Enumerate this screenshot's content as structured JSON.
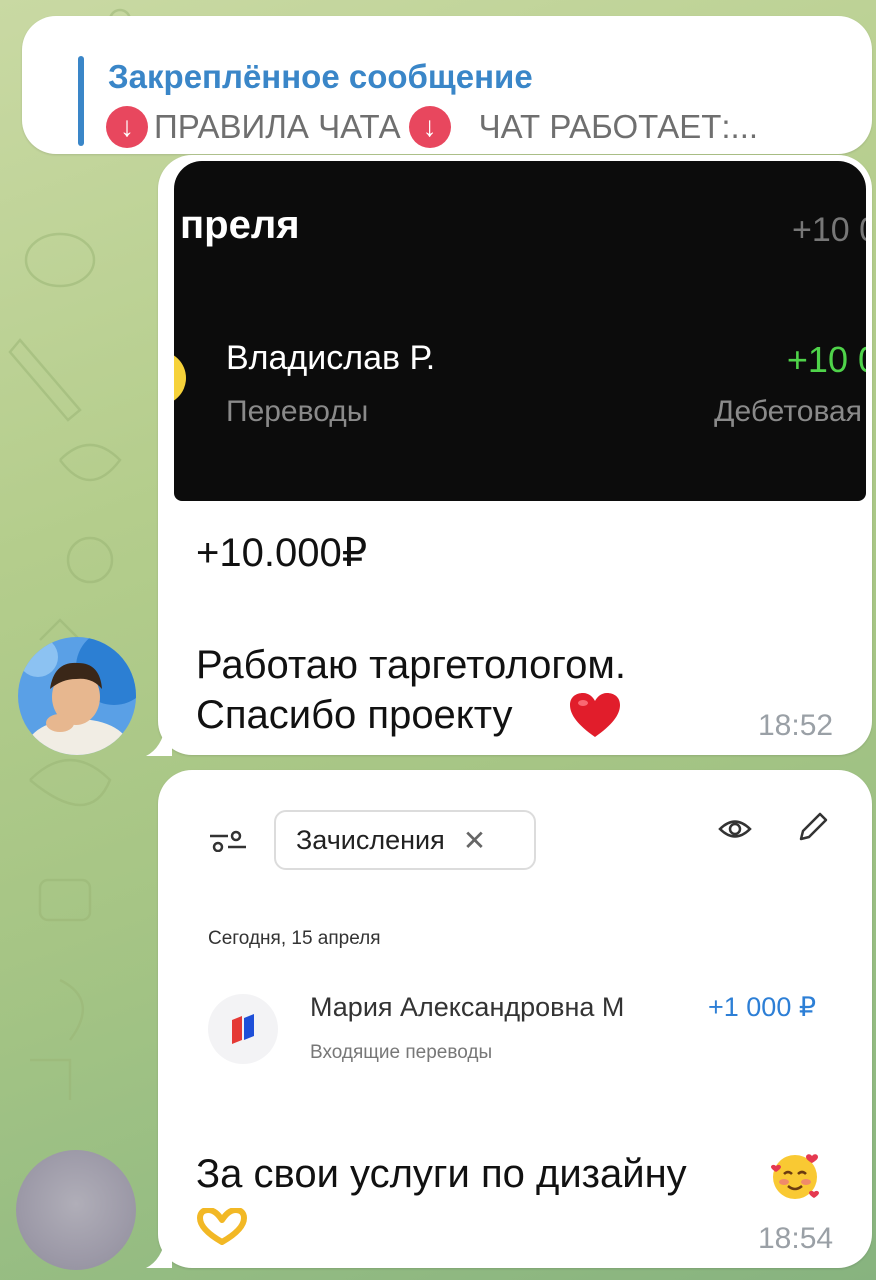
{
  "pinned": {
    "title": "Закреплённое сообщение",
    "preview_part1": "ПРАВИЛА ЧАТА",
    "preview_part2": "ЧАТ РАБОТАЕТ:..."
  },
  "message1": {
    "screenshot": {
      "month": "преля",
      "top_amount": "+10 0",
      "name": "Владислав Р.",
      "amount": "+10 0",
      "category": "Переводы",
      "card": "Дебетовая"
    },
    "line1": "+10.000₽",
    "line2": "Работаю таргетологом.",
    "line3": "Спасибо проекту",
    "time": "18:52"
  },
  "message2": {
    "screenshot": {
      "chip_label": "Зачисления",
      "date": "Сегодня, 15 апреля",
      "payer": "Мария Александровна М",
      "amount": "+1 000 ₽",
      "category": "Входящие переводы"
    },
    "line1": "За свои услуги по дизайну",
    "time": "18:54"
  },
  "colors": {
    "accent": "#3a86c8",
    "pin_badge": "#e8475e",
    "income_green": "#4fd34a",
    "income_blue": "#2d7fd6"
  },
  "icons": [
    "arrow-down-icon",
    "filter-icon",
    "close-icon",
    "eye-icon",
    "pencil-icon",
    "bank-logo-icon",
    "heart-emoji-icon",
    "smiling-hearts-emoji-icon",
    "heart-hands-emoji-icon"
  ]
}
